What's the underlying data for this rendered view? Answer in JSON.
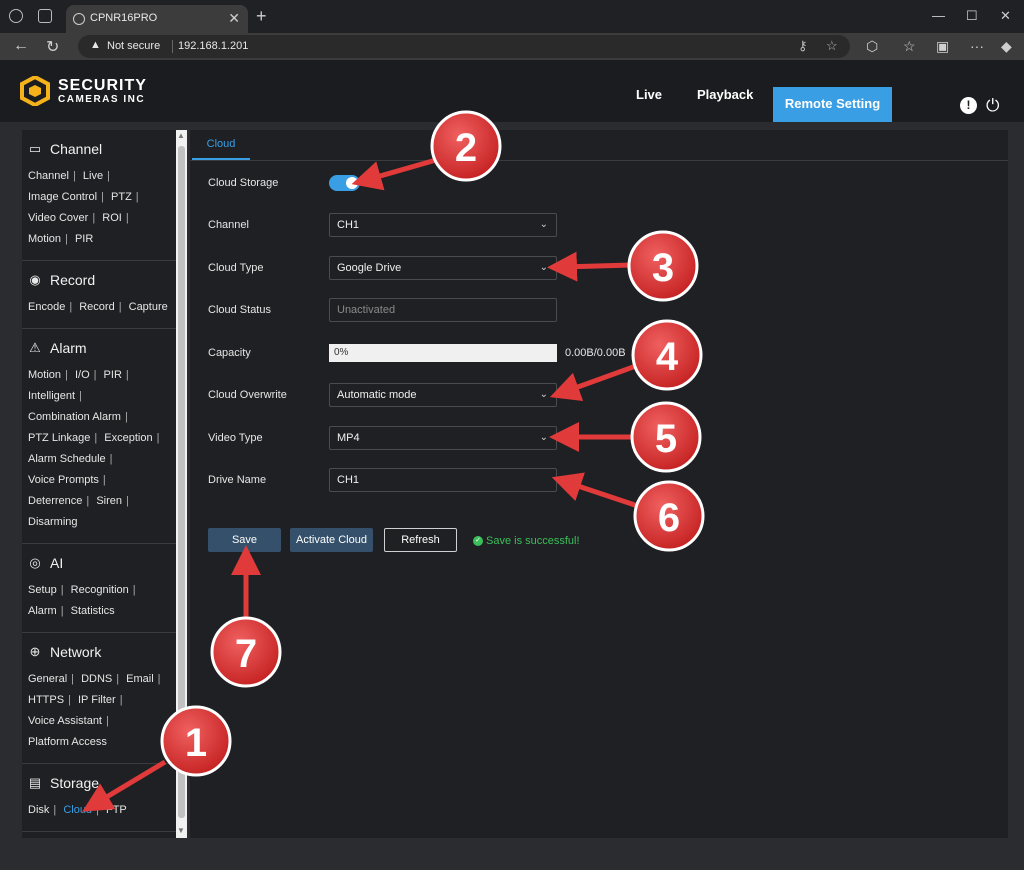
{
  "browser": {
    "tab_title": "CPNR16PRO",
    "tab_close": "✕",
    "new_tab": "+",
    "not_secure": "Not secure",
    "url": "192.168.1.201",
    "win_min": "—",
    "win_max": "☐",
    "win_close": "✕",
    "more": "···"
  },
  "brand": {
    "line1": "SECURITY",
    "line2": "CAMERAS INC",
    "color": "#f5b21a"
  },
  "topnav": {
    "live": "Live",
    "playback": "Playback",
    "remote_setting": "Remote Setting",
    "accent": "#3a9ee4"
  },
  "sidebar": {
    "sections": [
      {
        "title": "Channel",
        "icon": "monitor-icon",
        "links": [
          "Channel",
          "Live",
          "Image Control",
          "PTZ",
          "Video Cover",
          "ROI",
          "Motion",
          "PIR"
        ]
      },
      {
        "title": "Record",
        "icon": "record-icon",
        "links": [
          "Encode",
          "Record",
          "Capture"
        ]
      },
      {
        "title": "Alarm",
        "icon": "alarm-icon",
        "links": [
          "Motion",
          "I/O",
          "PIR",
          "Intelligent",
          "Combination Alarm",
          "PTZ Linkage",
          "Exception",
          "Alarm Schedule",
          "Voice Prompts",
          "Deterrence",
          "Siren",
          "Disarming"
        ]
      },
      {
        "title": "AI",
        "icon": "ai-icon",
        "links": [
          "Setup",
          "Recognition",
          "Alarm",
          "Statistics"
        ]
      },
      {
        "title": "Network",
        "icon": "globe-icon",
        "links": [
          "General",
          "DDNS",
          "Email",
          "HTTPS",
          "IP Filter",
          "Voice Assistant",
          "Platform Access"
        ]
      },
      {
        "title": "Storage",
        "icon": "storage-icon",
        "links": [
          "Disk",
          "Cloud",
          "FTP"
        ],
        "active": "Cloud"
      }
    ]
  },
  "cloud": {
    "tab": "Cloud",
    "storage_label": "Cloud Storage",
    "storage_on": true,
    "channel_label": "Channel",
    "channel_value": "CH1",
    "type_label": "Cloud Type",
    "type_value": "Google Drive",
    "status_label": "Cloud Status",
    "status_value": "Unactivated",
    "capacity_label": "Capacity",
    "capacity_percent": "0%",
    "capacity_value": "0.00B/0.00B",
    "overwrite_label": "Cloud Overwrite",
    "overwrite_value": "Automatic mode",
    "video_label": "Video Type",
    "video_value": "MP4",
    "drive_label": "Drive Name",
    "drive_value": "CH1",
    "save": "Save",
    "activate": "Activate Cloud",
    "refresh": "Refresh",
    "success": "Save is successful!"
  },
  "annotations": {
    "color": "#e03a3a",
    "markers": [
      "1",
      "2",
      "3",
      "4",
      "5",
      "6",
      "7"
    ]
  }
}
